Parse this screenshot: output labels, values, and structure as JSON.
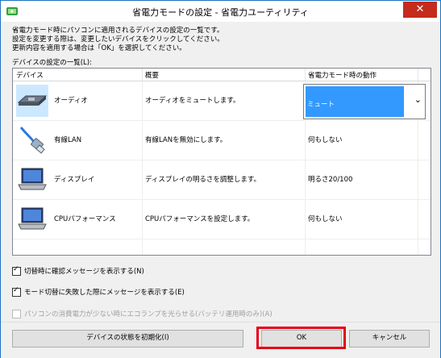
{
  "window": {
    "title": "省電力モードの設定 - 省電力ユーティリティ",
    "close_label": "✕"
  },
  "description": {
    "line1": "省電力モード時にパソコンに適用されるデバイスの設定の一覧です。",
    "line2": "設定を変更する際は、変更したいデバイスをクリックしてください。",
    "line3": "更新内容を適用する場合は「OK」を選択してください。"
  },
  "list": {
    "label": "デバイスの設定の一覧(L):",
    "columns": [
      "デバイス",
      "概要",
      "省電力モード時の動作"
    ],
    "rows": [
      {
        "name": "オーディオ",
        "summary": "オーディオをミュートします。",
        "action": "ミュート",
        "icon": "audio-card-icon"
      },
      {
        "name": "有線LAN",
        "summary": "有線LANを無効にします。",
        "action": "何もしない",
        "icon": "lan-cable-icon"
      },
      {
        "name": "ディスプレイ",
        "summary": "ディスプレイの明るさを調整します。",
        "action": "明るさ20/100",
        "icon": "laptop-display-icon"
      },
      {
        "name": "CPUパフォーマンス",
        "summary": "CPUパフォーマンスを設定します。",
        "action": "何もしない",
        "icon": "laptop-cpu-icon"
      }
    ]
  },
  "options": {
    "confirm_message": "切替時に確認メッセージを表示する(N)",
    "confirm_checked": true,
    "fail_message": "モード切替に失敗した際にメッセージを表示する(E)",
    "fail_checked": true,
    "eco_lamp": "パソコンの消費電力が少ない時にエコランプを光らせる(バッテリ運用時のみ)(A)",
    "eco_lamp_checked": false
  },
  "buttons": {
    "reset": "デバイスの状態を初期化(I)",
    "ok": "OK",
    "cancel": "キャンセル"
  },
  "colors": {
    "selection": "#3399ff",
    "highlight_box": "#e60012",
    "close_button": "#c42b1c"
  }
}
